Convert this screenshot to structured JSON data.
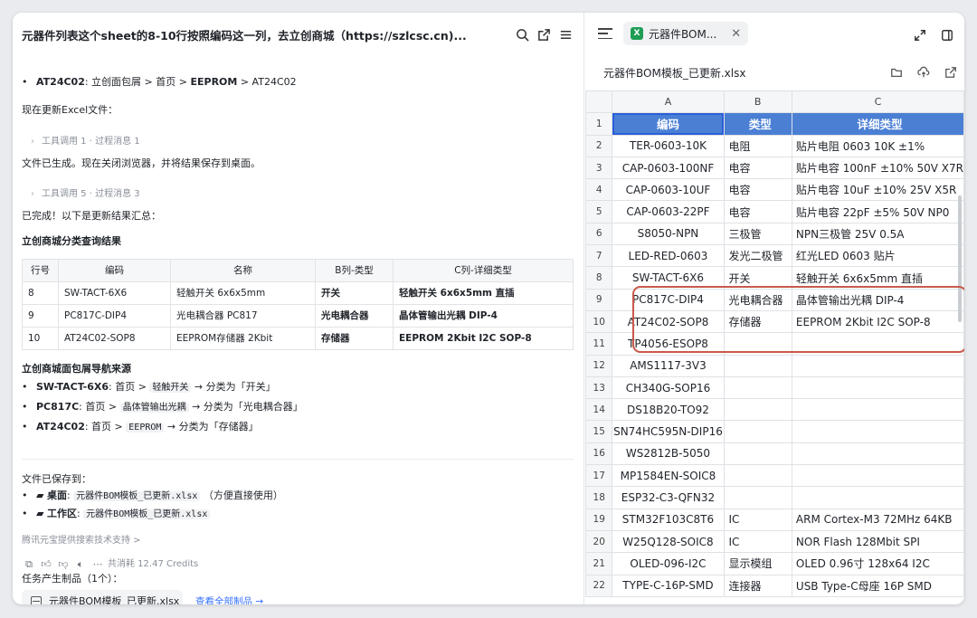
{
  "left_header": {
    "title": "元器件列表这个sheet的8-10行按照编码这一列，去立创商城（https://szlcsc.cn)..."
  },
  "chat": {
    "top_bullet": {
      "code": "AT24C02",
      "text": ": 立创面包屑 > 首页 > ",
      "bold": "EEPROM",
      "tail": " > AT24C02"
    },
    "msg1": "现在更新Excel文件：",
    "tool1": {
      "label": "工具调用 1",
      "sep": "·",
      "sub": "过程消息 1"
    },
    "msg2": "文件已生成。现在关闭浏览器，并将结果保存到桌面。",
    "tool2": {
      "label": "工具调用 5",
      "sep": "·",
      "sub": "过程消息 3"
    },
    "msg3": "已完成！以下是更新结果汇总：",
    "section1": "立创商城分类查询结果",
    "table": {
      "headers": [
        "行号",
        "编码",
        "名称",
        "B列-类型",
        "C列-详细类型"
      ],
      "rows": [
        [
          "8",
          "SW-TACT-6X6",
          "轻触开关 6x6x5mm",
          "开关",
          "轻触开关 6x6x5mm 直插"
        ],
        [
          "9",
          "PC817C-DIP4",
          "光电耦合器 PC817",
          "光电耦合器",
          "晶体管输出光耦 DIP-4"
        ],
        [
          "10",
          "AT24C02-SOP8",
          "EEPROM存储器 2Kbit",
          "存储器",
          "EEPROM 2Kbit I2C SOP-8"
        ]
      ]
    },
    "section2": "立创商城面包屑导航来源",
    "nav": [
      {
        "code": "SW-TACT-6X6",
        "pre": ": 首页 > ",
        "mid": "轻触开关",
        "post": " → 分类为「开关」"
      },
      {
        "code": "PC817C",
        "pre": ": 首页 > ",
        "mid": "晶体管输出光耦",
        "post": " → 分类为「光电耦合器」"
      },
      {
        "code": "AT24C02",
        "pre": ": 首页 > ",
        "mid": "EEPROM",
        "post": " → 分类为「存储器」"
      }
    ],
    "saved_title": "文件已保存到：",
    "saved": [
      {
        "label": "桌面",
        "file": "元器件BOM模板_已更新.xlsx",
        "note": "（方便直接使用）"
      },
      {
        "label": "工作区",
        "file": "元器件BOM模板_已更新.xlsx",
        "note": ""
      }
    ],
    "powered": "腾讯元宝提供搜索技术支持 >",
    "credits": "共消耗 12.47 Credits",
    "artifacts_title": "任务产生制品（1个）：",
    "artifact_name": "元器件BOM模板_已更新.xlsx",
    "view_all": "查看全部制品 →"
  },
  "right": {
    "tab_label": "元器件BOM...",
    "tab_icon": "X",
    "file_name": "元器件BOM模板_已更新.xlsx",
    "columns": [
      "A",
      "B",
      "C"
    ],
    "header_row": [
      "编码",
      "类型",
      "详细类型"
    ],
    "rows": [
      [
        "2",
        "TER-0603-10K",
        "电阻",
        "贴片电阻 0603 10K ±1%"
      ],
      [
        "3",
        "CAP-0603-100NF",
        "电容",
        "贴片电容 100nF ±10% 50V X7R"
      ],
      [
        "4",
        "CAP-0603-10UF",
        "电容",
        "贴片电容 10uF ±10% 25V X5R"
      ],
      [
        "5",
        "CAP-0603-22PF",
        "电容",
        "贴片电容 22pF ±5% 50V NP0"
      ],
      [
        "6",
        "S8050-NPN",
        "三极管",
        "NPN三极管 25V 0.5A"
      ],
      [
        "7",
        "LED-RED-0603",
        "发光二极管",
        "红光LED 0603 贴片"
      ],
      [
        "8",
        "SW-TACT-6X6",
        "开关",
        "轻触开关 6x6x5mm 直插"
      ],
      [
        "9",
        "PC817C-DIP4",
        "光电耦合器",
        "晶体管输出光耦 DIP-4"
      ],
      [
        "10",
        "AT24C02-SOP8",
        "存储器",
        "EEPROM 2Kbit I2C SOP-8"
      ],
      [
        "11",
        "TP4056-ESOP8",
        "",
        ""
      ],
      [
        "12",
        "AMS1117-3V3",
        "",
        ""
      ],
      [
        "13",
        "CH340G-SOP16",
        "",
        ""
      ],
      [
        "14",
        "DS18B20-TO92",
        "",
        ""
      ],
      [
        "15",
        "SN74HC595N-DIP16",
        "",
        ""
      ],
      [
        "16",
        "WS2812B-5050",
        "",
        ""
      ],
      [
        "17",
        "MP1584EN-SOIC8",
        "",
        ""
      ],
      [
        "18",
        "ESP32-C3-QFN32",
        "",
        ""
      ],
      [
        "19",
        "STM32F103C8T6",
        "IC",
        "ARM Cortex-M3 72MHz 64KB"
      ],
      [
        "20",
        "W25Q128-SOIC8",
        "IC",
        "NOR Flash 128Mbit SPI"
      ],
      [
        "21",
        "OLED-096-I2C",
        "显示模组",
        "OLED 0.96寸 128x64 I2C"
      ],
      [
        "22",
        "TYPE-C-16P-SMD",
        "连接器",
        "USB Type-C母座 16P SMD"
      ]
    ],
    "header_row_num": "1",
    "highlight_color": "#c8594a",
    "header_fill": "#4a7fd4"
  }
}
